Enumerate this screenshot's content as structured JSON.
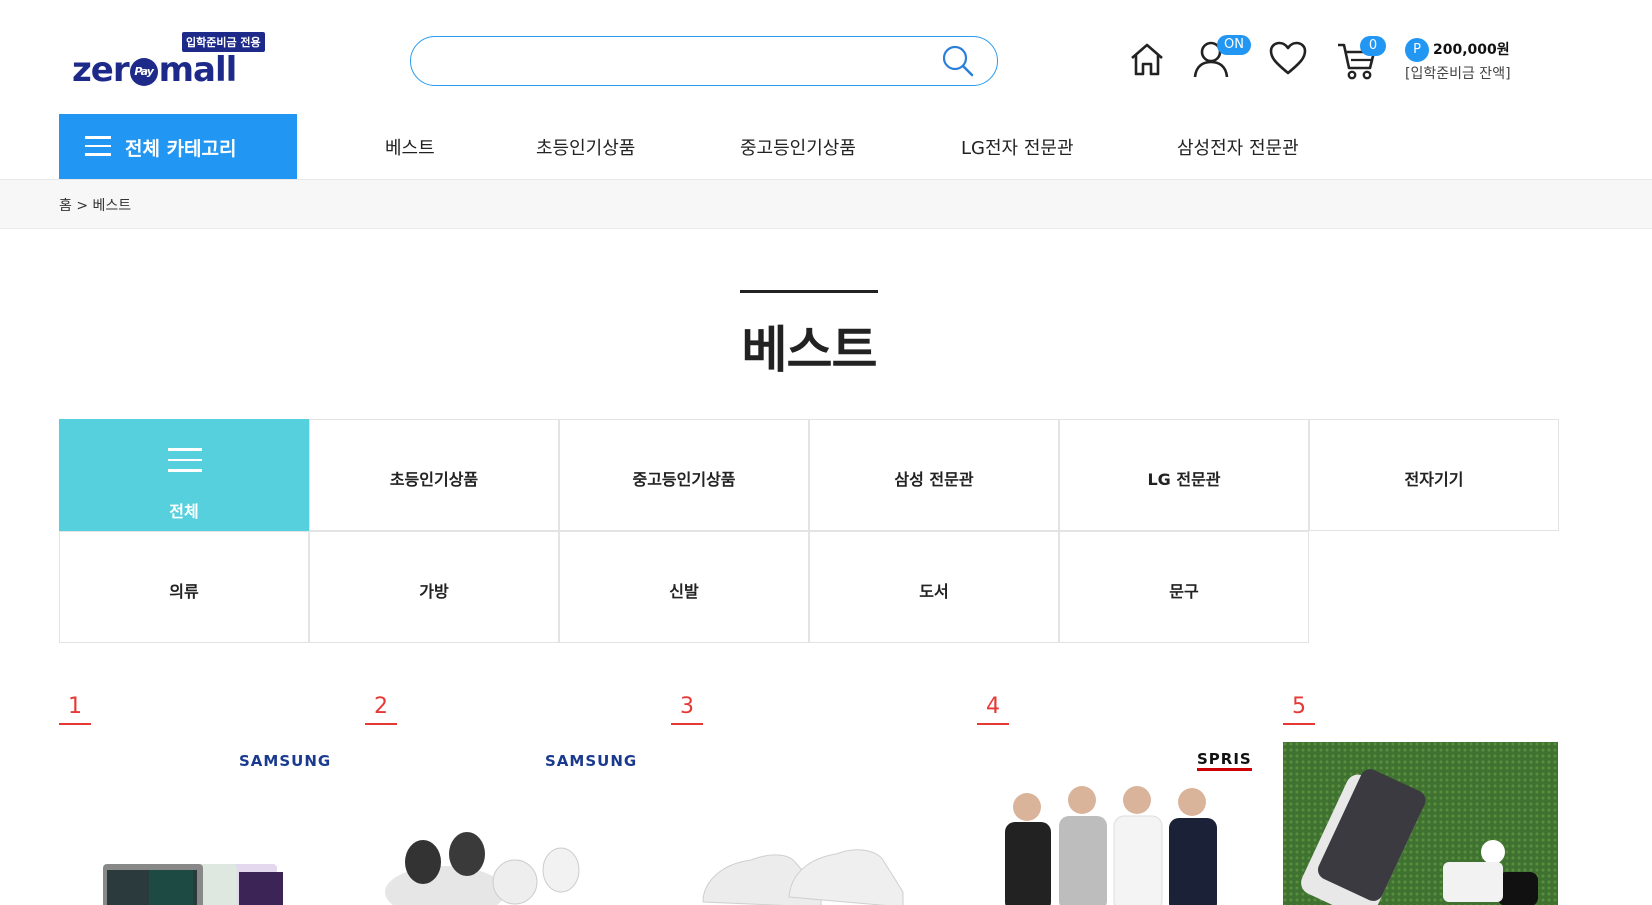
{
  "header": {
    "logo_badge": "입학준비금 전용",
    "logo_left": "zer",
    "logo_pay": "Pay",
    "logo_right": "mall",
    "search_placeholder": "",
    "on_badge": "ON",
    "cart_count": "0",
    "point_symbol": "P",
    "point_amount": "200,000원",
    "point_label": "[입학준비금 잔액]"
  },
  "nav": {
    "all_categories": "전체 카테고리",
    "items": [
      "베스트",
      "초등인기상품",
      "중고등인기상품",
      "LG전자 전문관",
      "삼성전자 전문관"
    ]
  },
  "breadcrumb": "홈 > 베스트",
  "page_title": "베스트",
  "categories": [
    "전체",
    "초등인기상품",
    "중고등인기상품",
    "삼성 전문관",
    "LG 전문관",
    "전자기기",
    "의류",
    "가방",
    "신발",
    "도서",
    "문구"
  ],
  "products": [
    {
      "rank": "1",
      "brand": "SAMSUNG"
    },
    {
      "rank": "2",
      "brand": "SAMSUNG"
    },
    {
      "rank": "3",
      "brand": ""
    },
    {
      "rank": "4",
      "brand": "SPRIS"
    },
    {
      "rank": "5",
      "brand": ""
    }
  ],
  "colors": {
    "accent_blue": "#2196f3",
    "active_category": "#56d0dc",
    "rank_red": "#e53935",
    "logo_navy": "#1e2a8a"
  },
  "icons": [
    "search-icon",
    "home-icon",
    "user-icon",
    "heart-icon",
    "cart-icon",
    "hamburger-icon"
  ]
}
